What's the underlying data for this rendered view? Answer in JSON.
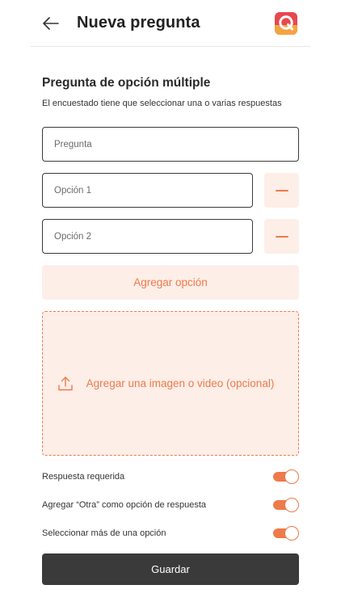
{
  "header": {
    "title": "Nueva pregunta"
  },
  "question": {
    "title": "Pregunta de opción múltiple",
    "subtitle": "El encuestado tiene que seleccionar una o varias respuestas",
    "question_placeholder": "Pregunta",
    "options": [
      {
        "placeholder": "Opción 1"
      },
      {
        "placeholder": "Opción 2"
      }
    ],
    "add_option_label": "Agregar opción",
    "upload_label": "Agregar una imagen o video (opcional)"
  },
  "settings": [
    {
      "label": "Respuesta requerida",
      "enabled": true
    },
    {
      "label": "Agregar “Otra” como opción de respuesta",
      "enabled": true
    },
    {
      "label": "Seleccionar más de una opción",
      "enabled": true
    }
  ],
  "save_label": "Guardar",
  "colors": {
    "accent": "#ee7a4a",
    "accent_light": "#fdeee8",
    "dark_button": "#3a3a3a",
    "logo_red": "#e8474f"
  }
}
